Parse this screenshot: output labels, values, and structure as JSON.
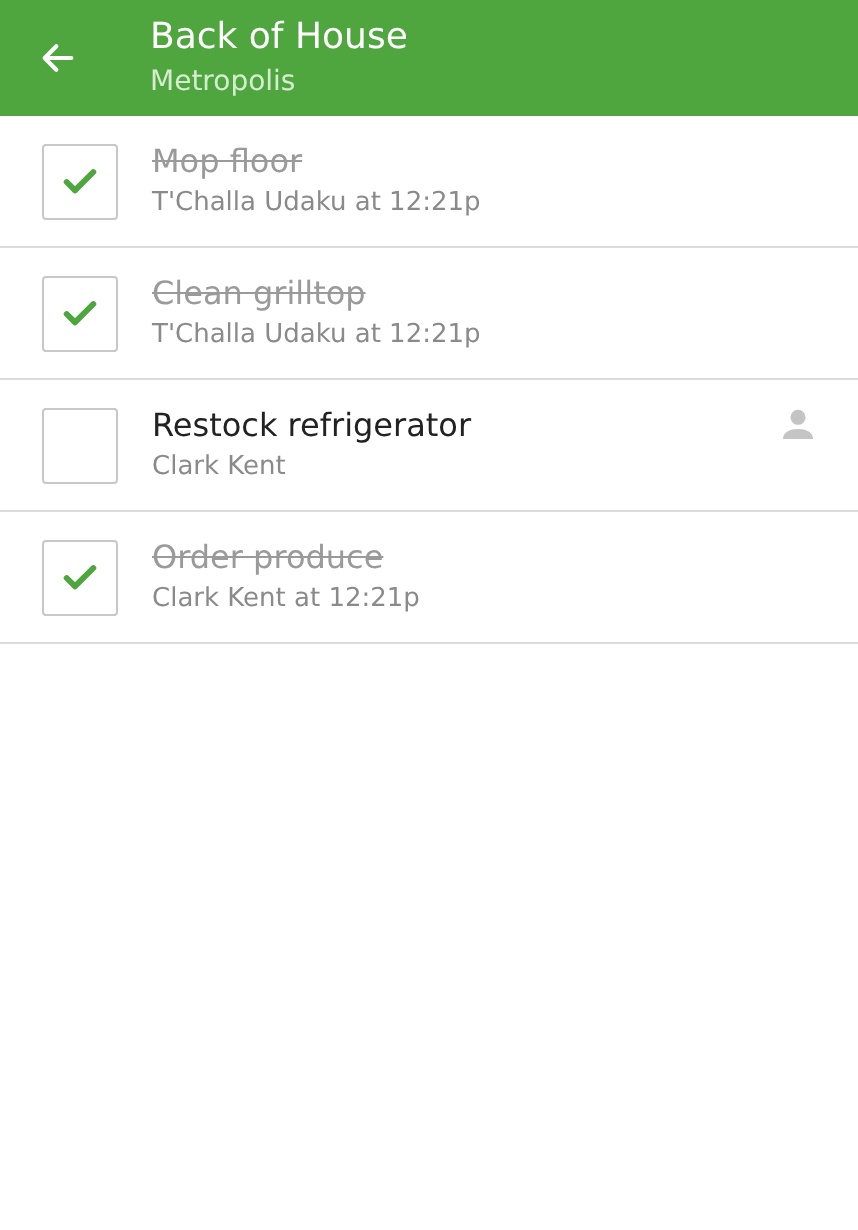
{
  "header": {
    "title": "Back of House",
    "subtitle": "Metropolis"
  },
  "tasks": [
    {
      "title": "Mop floor",
      "detail": "T'Challa Udaku at 12:21p",
      "checked": true,
      "assigned": false
    },
    {
      "title": "Clean grilltop",
      "detail": "T'Challa Udaku at 12:21p",
      "checked": true,
      "assigned": false
    },
    {
      "title": "Restock refrigerator",
      "detail": "Clark Kent",
      "checked": false,
      "assigned": true
    },
    {
      "title": "Order produce",
      "detail": "Clark Kent at 12:21p",
      "checked": true,
      "assigned": false
    }
  ]
}
